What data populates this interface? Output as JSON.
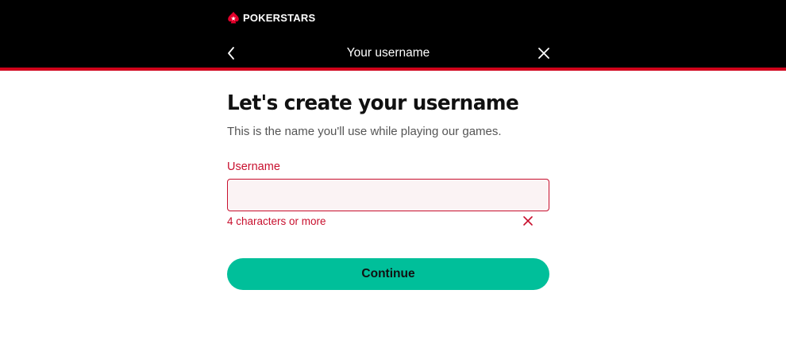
{
  "header": {
    "brand": "POKERSTARS",
    "title": "Your username",
    "back_icon": "chevron-left-icon",
    "close_icon": "close-icon",
    "background": "#000000",
    "accent_line": "#d0021b"
  },
  "main": {
    "heading": "Let's create your username",
    "subtitle": "This is the name you'll use while playing our games.",
    "username_field": {
      "label": "Username",
      "value": "",
      "placeholder": "",
      "hint": "4 characters or more",
      "hint_icon": "x-mark-icon",
      "error_color": "#c8102e"
    },
    "continue_label": "Continue",
    "continue_color": "#00bf9a"
  }
}
